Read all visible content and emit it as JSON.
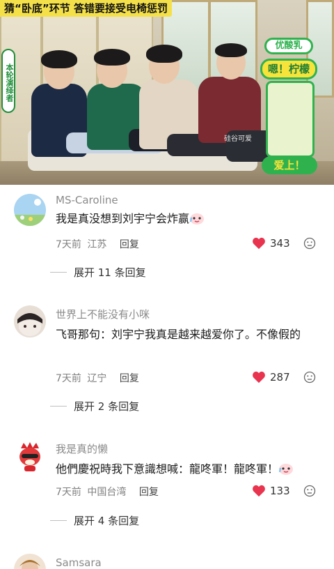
{
  "video": {
    "title_banner": "猜“卧底”环节 答错要接受电椅惩罚",
    "side_tag": "本轮演绎者",
    "brand_top": "优酸乳",
    "brand_mid": "嗯！柠檬",
    "brand_bottom": "爱上！",
    "watermark": "硅谷可爱"
  },
  "comments": [
    {
      "username": "MS-Caroline",
      "text": "我是真没想到刘宇宁会炸赢",
      "date": "7天前",
      "location": "江苏",
      "reply_label": "回复",
      "likes": "343",
      "expand_label": "展开 11 条回复",
      "avatar": "landscape-avatar"
    },
    {
      "username": "世界上不能没有小咪",
      "text": "飞哥那句：刘宇宁我真是越来越爱你了。不像假的",
      "date": "7天前",
      "location": "辽宁",
      "reply_label": "回复",
      "likes": "287",
      "expand_label": "展开 2 条回复",
      "avatar": "cat-avatar"
    },
    {
      "username": "我是真的懒",
      "text": "他們慶祝時我下意識想喊：龍咚軍！龍咚軍！",
      "date": "7天前",
      "location": "中国台湾",
      "reply_label": "回复",
      "likes": "133",
      "expand_label": "展开 4 条回复",
      "avatar": "red-character-avatar"
    },
    {
      "username": "Samsara",
      "avatar": "portrait-avatar"
    }
  ],
  "colors": {
    "like_heart": "#e8344e",
    "meta_text": "#7f7f7f",
    "username_text": "#8a8a8a"
  },
  "icons": {
    "like": "heart-icon",
    "dislike": "dislike-face-icon",
    "emoji": "crying-face-emoji"
  }
}
